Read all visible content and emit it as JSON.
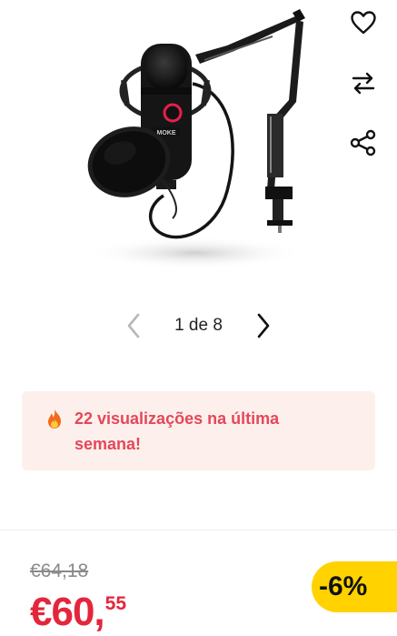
{
  "product": {
    "image_alt": "Microfone de estúdio com braço articulado e filtro anti-pop",
    "brand_label": "MOKE"
  },
  "actions": {
    "favorite_icon": "heart-icon",
    "compare_icon": "swap-arrows-icon",
    "share_icon": "share-icon"
  },
  "gallery": {
    "current": 1,
    "total": 8,
    "counter_label": "1 de 8"
  },
  "alert": {
    "icon": "fire-icon",
    "text": "22 visualizações na última semana!"
  },
  "pricing": {
    "old_price": "€64,18",
    "price_main": "€60,",
    "price_cents": "55",
    "discount": "-6%",
    "colors": {
      "price": "#e3263c",
      "discount_bg": "#ffd200",
      "alert_text": "#e4475a",
      "alert_bg": "#fdf0ec"
    }
  }
}
